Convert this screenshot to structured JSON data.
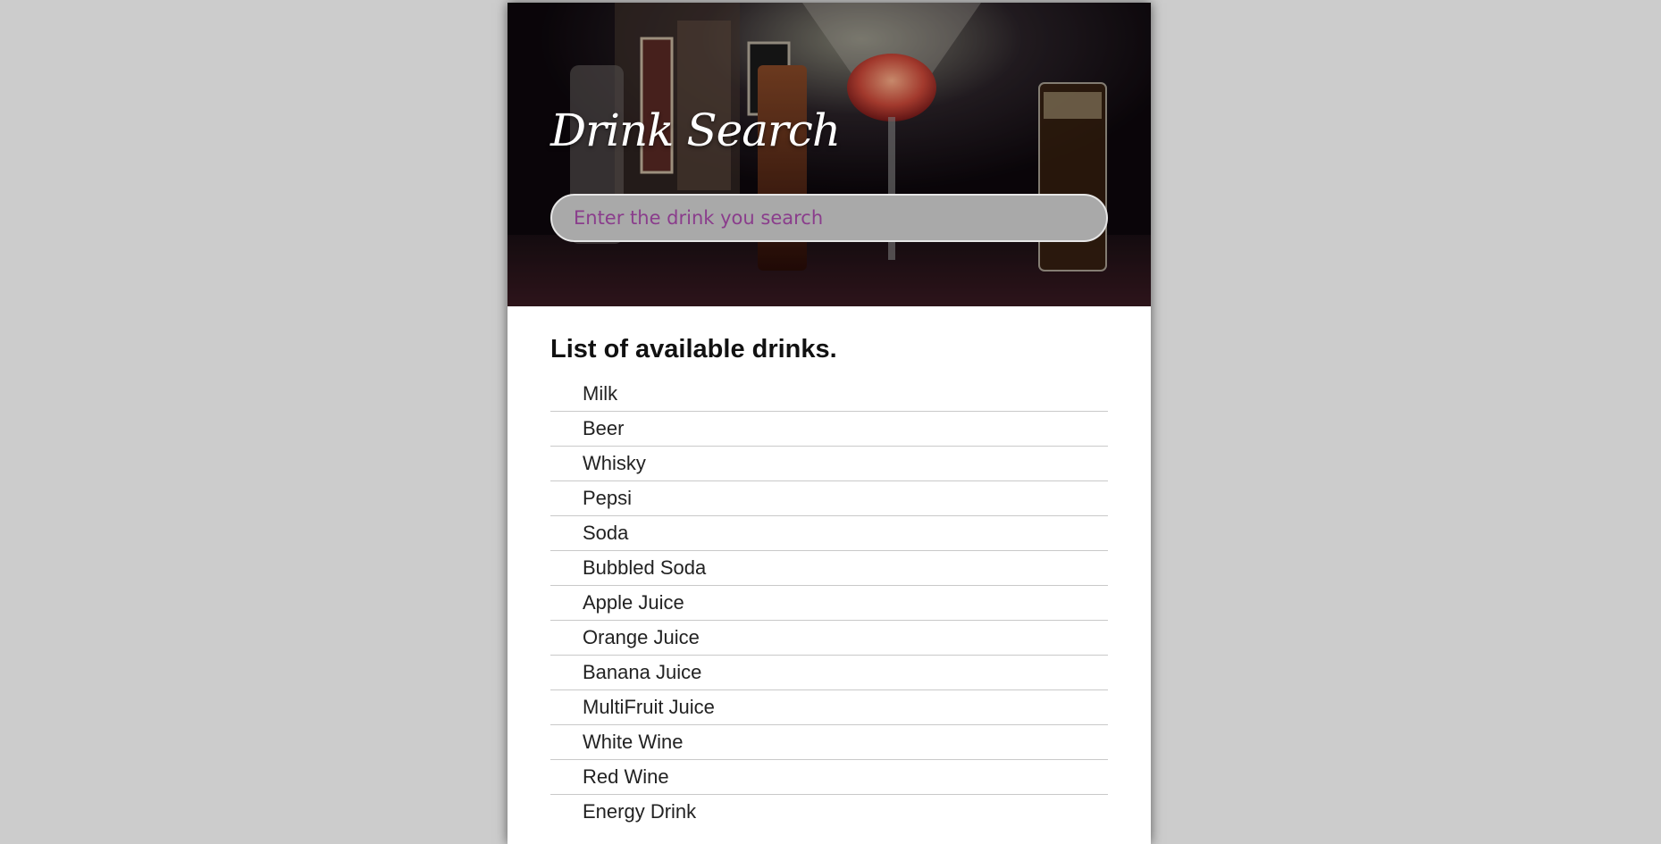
{
  "header": {
    "title": "Drink Search"
  },
  "search": {
    "placeholder": "Enter the drink you search",
    "value": ""
  },
  "main": {
    "heading": "List of available drinks.",
    "drinks": [
      "Milk",
      "Beer",
      "Whisky",
      "Pepsi",
      "Soda",
      "Bubbled Soda",
      "Apple Juice",
      "Orange Juice",
      "Banana Juice",
      "MultiFruit Juice",
      "White Wine",
      "Red Wine",
      "Energy Drink"
    ]
  },
  "colors": {
    "page_background": "#cccccc",
    "card_background": "#ffffff",
    "search_background": "#a9a9a9",
    "placeholder_color": "#8a3d8c",
    "divider": "#c9c9c9"
  },
  "images": {
    "hero": "bar-drinks-photo"
  }
}
